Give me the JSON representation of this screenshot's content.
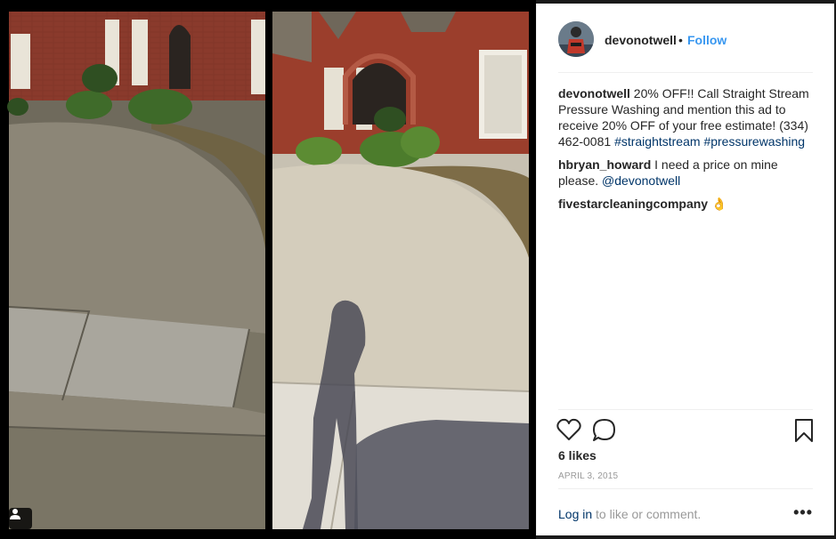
{
  "post": {
    "username": "devonotwell",
    "separator": "•",
    "follow_label": "Follow",
    "caption": {
      "user": "devonotwell",
      "text": " 20% OFF!! Call Straight Stream Pressure Washing and mention this ad to receive 20% OFF of your free estimate! (334) 462-0081 ",
      "hashtag1": "#straightstream",
      "hashtag2": "#pressurewashing"
    },
    "comments": [
      {
        "user": "hbryan_howard",
        "text": " I need a price on mine please. ",
        "mention": "@devonotwell"
      },
      {
        "user": "fivestarcleaningcompany",
        "text": " 👌"
      }
    ],
    "likes": "6 likes",
    "date": "APRIL 3, 2015",
    "login_link": "Log in",
    "login_rest": " to like or comment.",
    "more": "•••"
  },
  "icons": {
    "like": "heart-icon",
    "comment": "comment-bubble-icon",
    "save": "bookmark-icon",
    "tagged": "person-tag-icon",
    "more": "more-options-icon"
  },
  "colors": {
    "accent": "#3897f0",
    "link": "#003569",
    "text": "#262626",
    "muted": "#999999"
  }
}
